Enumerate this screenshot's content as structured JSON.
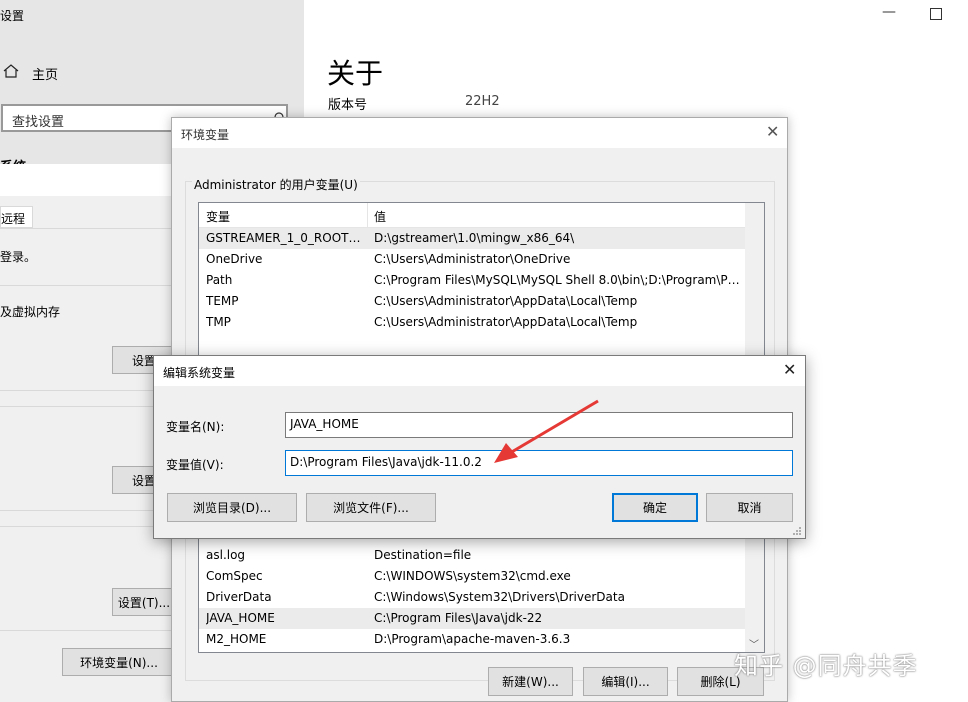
{
  "settings": {
    "window_title": "设置",
    "home_label": "主页",
    "search_placeholder": "查找设置",
    "section_label": "系统",
    "about_title": "关于",
    "version_label": "版本号",
    "version_value": "22H2"
  },
  "sysprops": {
    "tab_label": "远程",
    "line1": "登录。",
    "line2": "及虚拟内存",
    "btn_settings1": "设置",
    "btn_settings2": "设置",
    "btn_settings3": "设置(T)...",
    "btn_env": "环境变量(N)..."
  },
  "env_dialog": {
    "title": "环境变量",
    "user_group_label": "Administrator 的用户变量(U)",
    "col_var": "变量",
    "col_val": "值",
    "user_vars": [
      {
        "name": "GSTREAMER_1_0_ROOT_...",
        "value": "D:\\gstreamer\\1.0\\mingw_x86_64\\"
      },
      {
        "name": "OneDrive",
        "value": "C:\\Users\\Administrator\\OneDrive"
      },
      {
        "name": "Path",
        "value": "C:\\Program Files\\MySQL\\MySQL Shell 8.0\\bin\\;D:\\Program\\Py..."
      },
      {
        "name": "TEMP",
        "value": "C:\\Users\\Administrator\\AppData\\Local\\Temp"
      },
      {
        "name": "TMP",
        "value": "C:\\Users\\Administrator\\AppData\\Local\\Temp"
      }
    ],
    "sys_vars": [
      {
        "name": "asl.log",
        "value": "Destination=file"
      },
      {
        "name": "ComSpec",
        "value": "C:\\WINDOWS\\system32\\cmd.exe"
      },
      {
        "name": "DriverData",
        "value": "C:\\Windows\\System32\\Drivers\\DriverData"
      },
      {
        "name": "JAVA_HOME",
        "value": "C:\\Program Files\\Java\\jdk-22"
      },
      {
        "name": "M2_HOME",
        "value": "D:\\Program\\apache-maven-3.6.3"
      }
    ],
    "btn_new": "新建(W)...",
    "btn_edit": "编辑(I)...",
    "btn_delete": "删除(L)"
  },
  "edit_dialog": {
    "title": "编辑系统变量",
    "name_label": "变量名(N):",
    "value_label": "变量值(V):",
    "name_value": "JAVA_HOME",
    "value_value": "D:\\Program Files\\Java\\jdk-11.0.2",
    "btn_browse_dir": "浏览目录(D)...",
    "btn_browse_file": "浏览文件(F)...",
    "btn_ok": "确定",
    "btn_cancel": "取消"
  },
  "watermark": "知乎 @同舟共季",
  "colors": {
    "accent": "#0078d7",
    "arrow": "#e53935"
  }
}
